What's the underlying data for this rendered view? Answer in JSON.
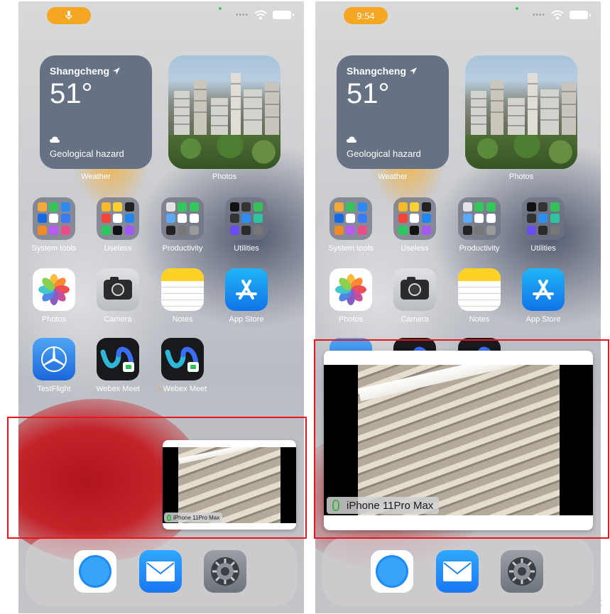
{
  "left_screen": {
    "status_icon": "microphone-icon"
  },
  "right_screen": {
    "status_time": "9:54"
  },
  "weather_widget": {
    "city": "Shangcheng",
    "temperature": "51°",
    "condition": "Geological hazard",
    "label": "Weather",
    "condition_icon": "cloud-icon",
    "location_icon": "location-arrow-icon"
  },
  "photos_widget": {
    "label": "Photos"
  },
  "folders": [
    {
      "label": "System tools"
    },
    {
      "label": "Useless"
    },
    {
      "label": "Productivity"
    },
    {
      "label": "Utilities"
    }
  ],
  "apps_row2": [
    {
      "label": "Photos",
      "icon": "photos-icon"
    },
    {
      "label": "Camera",
      "icon": "camera-icon"
    },
    {
      "label": "Notes",
      "icon": "notes-icon"
    },
    {
      "label": "App Store",
      "icon": "app-store-icon"
    }
  ],
  "apps_row3": [
    {
      "label": "TestFlight",
      "icon": "testflight-icon"
    },
    {
      "label": "Webex Meet",
      "icon": "webex-meet-icon"
    },
    {
      "label": "Webex Meet",
      "icon": "webex-meet-icon"
    }
  ],
  "dock": [
    {
      "icon": "safari-icon"
    },
    {
      "icon": "mail-icon"
    },
    {
      "icon": "settings-icon"
    }
  ],
  "pip": {
    "device_label": "iPhone 11Pro Max"
  },
  "colors": {
    "highlight_box": "#e8161c",
    "status_pill": "#f5a623",
    "weather_widget": "#667184"
  }
}
